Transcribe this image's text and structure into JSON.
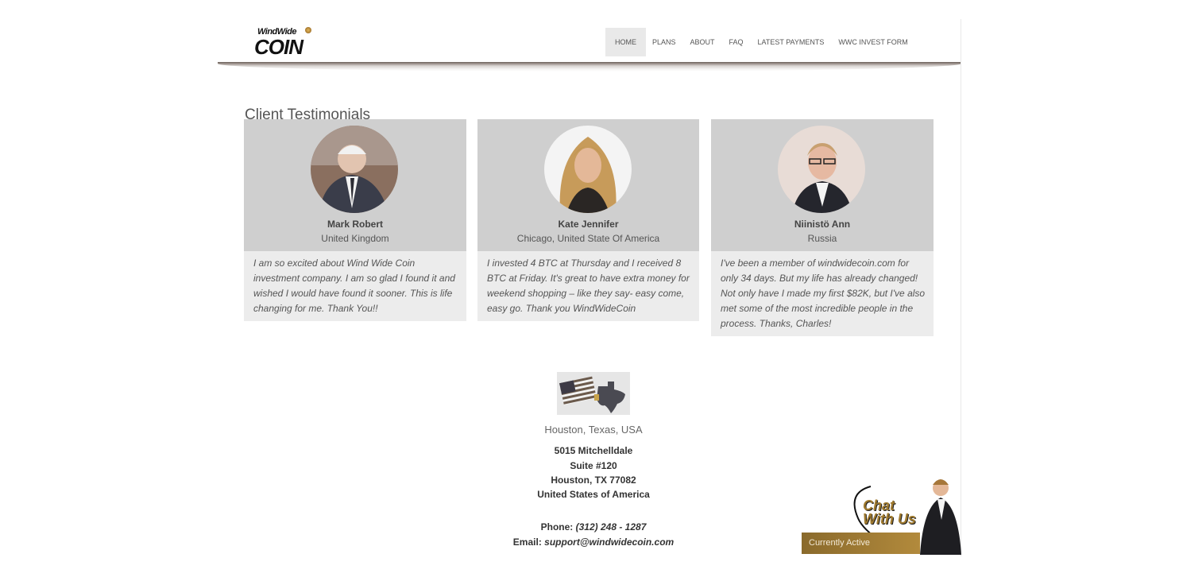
{
  "logo": {
    "top": "WindWide",
    "main": "COIN"
  },
  "nav": {
    "items": [
      {
        "label": "HOME",
        "active": true
      },
      {
        "label": "PLANS",
        "active": false
      },
      {
        "label": "ABOUT",
        "active": false
      },
      {
        "label": "FAQ",
        "active": false
      },
      {
        "label": "LATEST PAYMENTS",
        "active": false
      },
      {
        "label": "WWC INVEST FORM",
        "active": false
      }
    ]
  },
  "testimonials": {
    "title": "Client Testimonials",
    "cards": [
      {
        "name": "Mark Robert",
        "location": "United Kingdom",
        "quote": "I am so excited about Wind Wide Coin investment company. I am so glad I found it and wished I would have found it sooner. This is life changing for me. Thank You!!"
      },
      {
        "name": "Kate Jennifer",
        "location": "Chicago, United State Of America",
        "quote": "I invested 4 BTC at Thursday and I received 8 BTC at Friday. It's great to have extra money for weekend shopping – like they say- easy come, easy go. Thank you WindWideCoin"
      },
      {
        "name": "Niinistö Ann",
        "location": "Russia",
        "quote": "I've been a member of windwidecoin.com for only 34 days. But my life has already changed! Not only have I made my first $82K, but I've also met some of the most incredible people in the process. Thanks, Charles!"
      }
    ]
  },
  "address": {
    "city": "Houston, Texas, USA",
    "line1": "5015 Mitchelldale",
    "line2": "Suite #120",
    "line3": "Houston, TX 77082",
    "line4": "United States of America",
    "phone_label": "Phone:",
    "phone": "(312) 248 - 1287",
    "email_label": "Email:",
    "email": "support@windwidecoin.com"
  },
  "chat": {
    "line1": "Chat",
    "line2": "With Us",
    "status": "Currently Active"
  },
  "colors": {
    "accent": "#a07a2e",
    "card_bg": "#cfcfcf",
    "quote_bg": "#ececec"
  }
}
